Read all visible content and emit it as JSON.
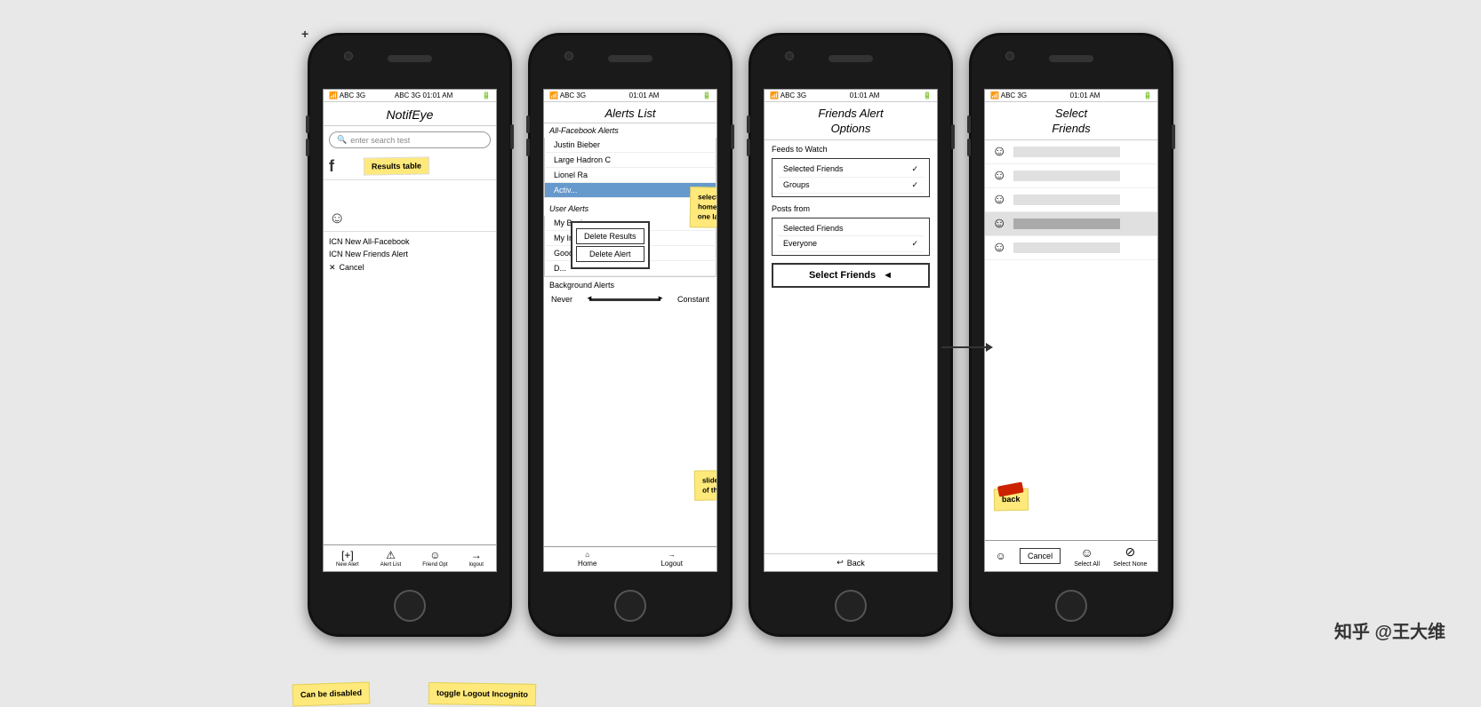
{
  "phones": [
    {
      "id": "phone1",
      "title": "NotifEye",
      "status": "ABC 3G  01:01 AM",
      "search_placeholder": "enter search test",
      "notifications": [
        "ICN New All-Facebook",
        "ICN New Friends Alert",
        "X   Cancel"
      ],
      "results_label": "Results table",
      "bottom_bar": [
        {
          "icon": "+",
          "label": "New Alert"
        },
        {
          "icon": "⚠",
          "label": "Alert List"
        },
        {
          "icon": "☻",
          "label": "Friend Opt"
        },
        {
          "icon": "→",
          "label": "logout"
        }
      ],
      "sticky_can_be_disabled": "Can be\ndisabled",
      "sticky_toggle": "toggle\nLogout\nIncognito"
    },
    {
      "id": "phone2",
      "title": "Alerts List",
      "status": "ABC 3G  01:01 AM",
      "all_facebook_section": "All-Facebook Alerts",
      "all_facebook_items": [
        "Justin Bieber",
        "Large Hadron C",
        "Lionel Ra"
      ],
      "active_item": "Activ...",
      "popup_buttons": [
        "Delete Results",
        "Delete Alert"
      ],
      "user_alerts_section": "User Alerts",
      "user_alert_items": [
        "My Busine",
        "My Insec",
        "Good Dop"
      ],
      "user_item_d": "D...",
      "bg_alerts_label": "Background Alerts",
      "bg_never": "Never",
      "bg_constant": "Constant",
      "bottom_bar": [
        {
          "icon": "⌂",
          "label": "Home"
        },
        {
          "icon": "→",
          "label": "Logout"
        }
      ],
      "sticky_select_returns": "select returns\nto home\nmay be only one\nlarge table",
      "sticky_slides_away": "slides away\nmost of the"
    },
    {
      "id": "phone3",
      "title": "Friends Alert\nOptions",
      "status": "ABC 3G  01:01 AM",
      "feeds_to_watch_label": "Feeds to Watch",
      "feeds_options": [
        {
          "name": "Selected Friends",
          "checked": true
        },
        {
          "name": "Groups",
          "checked": true
        }
      ],
      "posts_from_label": "Posts from",
      "posts_options": [
        {
          "name": "Selected Friends",
          "checked": false
        },
        {
          "name": "Everyone",
          "checked": true
        }
      ],
      "select_friends_btn": "Select Friends",
      "back_label": "Back"
    },
    {
      "id": "phone4",
      "title": "Select\nFriends",
      "status": "ABC 3G  01:01 AM",
      "friends": [
        {
          "selected": false
        },
        {
          "selected": false
        },
        {
          "selected": false
        },
        {
          "selected": true
        },
        {
          "selected": false
        }
      ],
      "cancel_btn": "Cancel",
      "back_label": "back",
      "select_all_label": "Select All",
      "select_none_label": "Select None"
    }
  ],
  "watermark": "知乎 @王大维"
}
